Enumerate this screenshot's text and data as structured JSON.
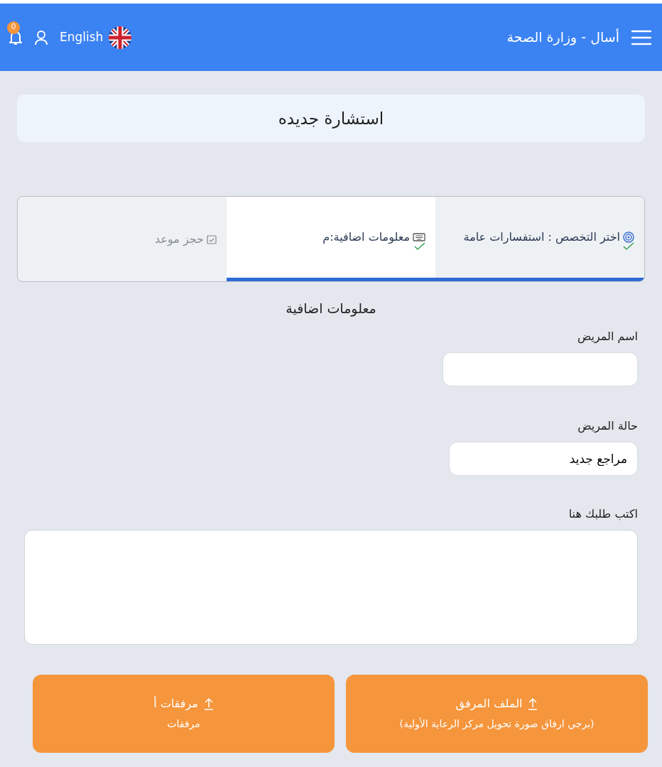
{
  "header": {
    "title": "أسال - وزارة الصحة",
    "language": "English",
    "notifications": "0"
  },
  "page_title": "استشارة جديده",
  "steps": [
    {
      "label": "اختر التخصص : استفسارات عامة",
      "done": true,
      "selected": false
    },
    {
      "label": "معلومات اضافية:م",
      "done": true,
      "selected": true
    },
    {
      "label": "حجز موعد",
      "done": false,
      "selected": false
    }
  ],
  "section_title": "معلومات اضافية",
  "fields": [
    {
      "kind": "input",
      "label": "اسم المريض"
    },
    {
      "kind": "input",
      "label": "حالة المريض",
      "value": "مراجع جديد"
    },
    {
      "kind": "textarea",
      "label": "اكتب طلبك هنا"
    }
  ],
  "uploads": [
    {
      "title": "الملف المرفق",
      "hint": "(برجي ارفاق صورة تحويل مركز الرعاية الأولية)"
    },
    {
      "title": "مرفقات أ",
      "hint": "مرفقات"
    }
  ]
}
